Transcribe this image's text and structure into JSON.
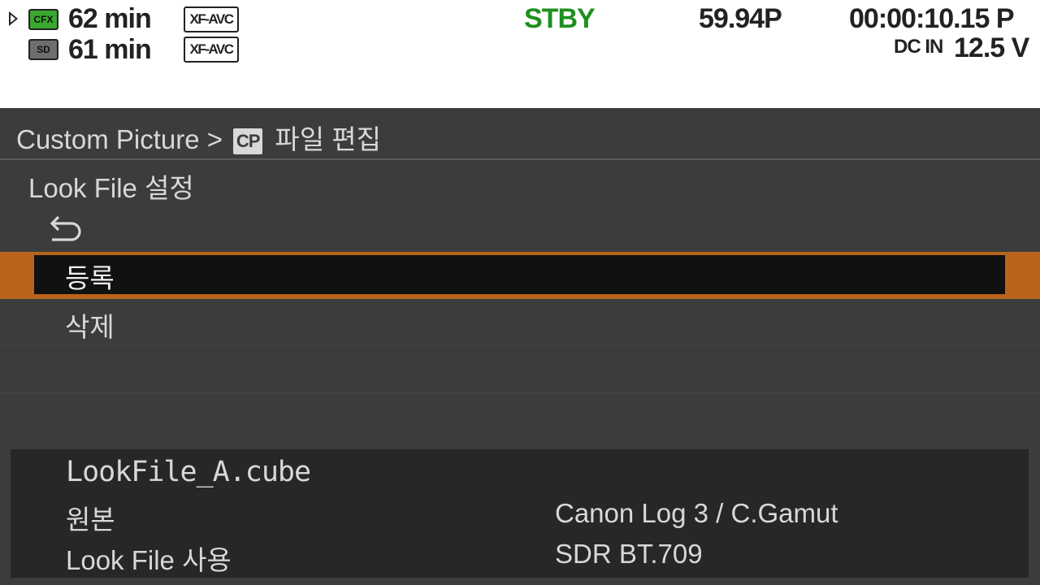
{
  "status": {
    "media": [
      {
        "icon": "play-icon",
        "badge": "CFX",
        "remaining": "62 min",
        "format": "XF-AVC",
        "badge_color": "#3aa82e"
      },
      {
        "icon": "",
        "badge": "SD",
        "remaining": "61 min",
        "format": "XF-AVC",
        "badge_color": "#6e6e6e"
      }
    ],
    "mode": "STBY",
    "mode_color": "#1e8f1e",
    "frame_rate": "59.94P",
    "timecode": "00:00:10.15",
    "timecode_flag": "P",
    "power_source": "DC IN",
    "voltage": "12.5",
    "voltage_unit": "V"
  },
  "menu": {
    "breadcrumb_root": "Custom Picture >",
    "breadcrumb_icon_text": "CP",
    "breadcrumb_page": "파일 편집",
    "section_title": "Look File 설정",
    "back_icon": "return-arrow-icon",
    "items": [
      {
        "label": "등록",
        "selected": true
      },
      {
        "label": "삭제",
        "selected": false
      }
    ],
    "accent_color": "#b8641a"
  },
  "info": {
    "filename": "LookFile_A.cube",
    "rows": [
      {
        "label": "원본",
        "value": "Canon Log 3 / C.Gamut"
      },
      {
        "label": "Look File 사용",
        "value": "SDR BT.709"
      }
    ]
  }
}
